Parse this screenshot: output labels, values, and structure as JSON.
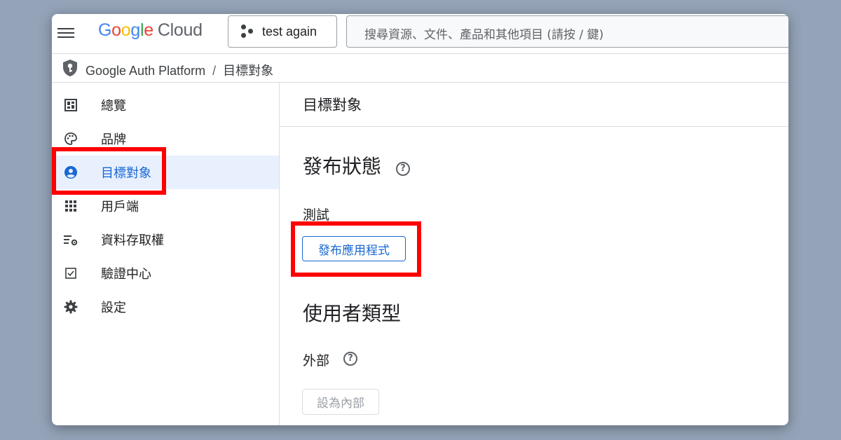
{
  "header": {
    "logo_parts": [
      "G",
      "o",
      "o",
      "g",
      "l",
      "e"
    ],
    "logo_suffix": "Cloud",
    "project_name": "test again",
    "search_placeholder": "搜尋資源、文件、產品和其他項目 (請按 / 鍵)"
  },
  "breadcrumb": {
    "product": "Google Auth Platform",
    "separator": "/",
    "current": "目標對象"
  },
  "sidebar": {
    "items": [
      {
        "label": "總覽",
        "icon": "dashboard-icon"
      },
      {
        "label": "品牌",
        "icon": "palette-icon"
      },
      {
        "label": "目標對象",
        "icon": "account-circle-icon",
        "active": true
      },
      {
        "label": "用戶端",
        "icon": "apps-grid-icon"
      },
      {
        "label": "資料存取權",
        "icon": "data-access-settings-icon"
      },
      {
        "label": "驗證中心",
        "icon": "checkbox-icon"
      },
      {
        "label": "設定",
        "icon": "gear-icon"
      }
    ]
  },
  "main": {
    "title": "目標對象",
    "publish_status": {
      "heading": "發布狀態",
      "status": "測試",
      "button_label": "發布應用程式"
    },
    "user_type": {
      "heading": "使用者類型",
      "type": "外部",
      "button_label": "設為內部"
    }
  },
  "help_glyph": "?",
  "colors": {
    "accent": "#1967d2",
    "active_bg": "#e8f0fe",
    "highlight": "#ff0000",
    "backdrop": "#94a3b8"
  }
}
